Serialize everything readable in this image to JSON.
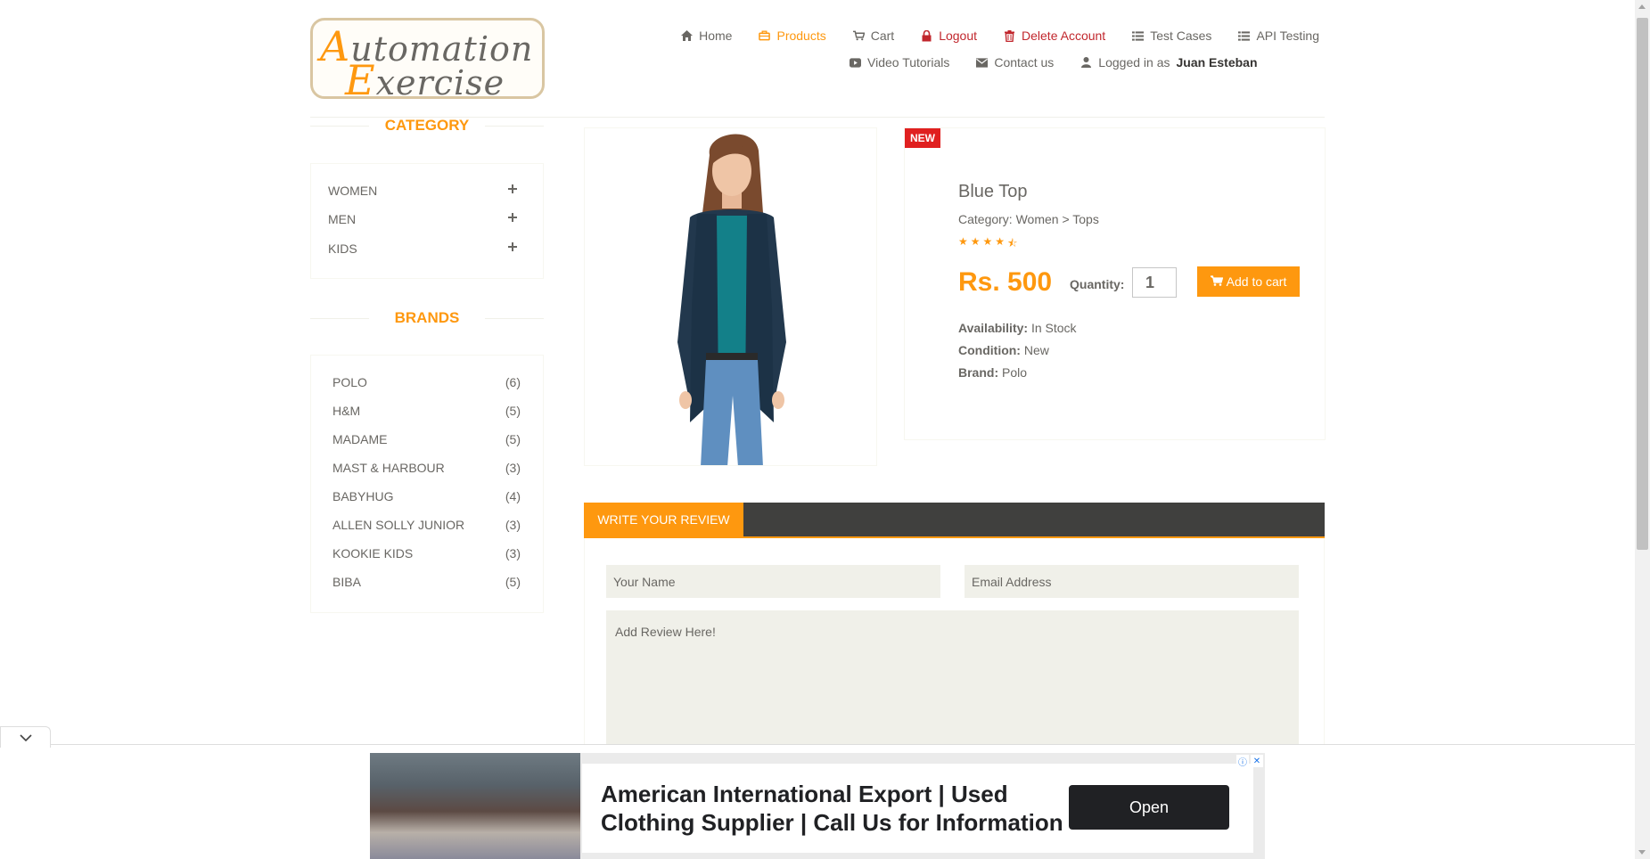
{
  "logo": {
    "line1_cap": "A",
    "line1_rest": "utomation",
    "line2_cap": "E",
    "line2_rest": "xercise"
  },
  "nav": {
    "home": "Home",
    "products": "Products",
    "cart": "Cart",
    "logout": "Logout",
    "delete_account": "Delete Account",
    "test_cases": "Test Cases",
    "api_testing": "API Testing",
    "video_tutorials": "Video Tutorials",
    "contact_us": "Contact us",
    "logged_in_prefix": "Logged in as",
    "logged_in_user": "Juan Esteban"
  },
  "sidebar": {
    "category_title": "CATEGORY",
    "categories": [
      {
        "label": "WOMEN"
      },
      {
        "label": "MEN"
      },
      {
        "label": "KIDS"
      }
    ],
    "brands_title": "BRANDS",
    "brands": [
      {
        "label": "POLO",
        "count": "(6)"
      },
      {
        "label": "H&M",
        "count": "(5)"
      },
      {
        "label": "MADAME",
        "count": "(5)"
      },
      {
        "label": "MAST & HARBOUR",
        "count": "(3)"
      },
      {
        "label": "BABYHUG",
        "count": "(4)"
      },
      {
        "label": "ALLEN SOLLY JUNIOR",
        "count": "(3)"
      },
      {
        "label": "KOOKIE KIDS",
        "count": "(3)"
      },
      {
        "label": "BIBA",
        "count": "(5)"
      }
    ]
  },
  "product": {
    "badge": "NEW",
    "name": "Blue Top",
    "category": "Category: Women > Tops",
    "rating": 4.5,
    "price": "Rs. 500",
    "quantity_label": "Quantity:",
    "quantity_value": "1",
    "add_to_cart": "Add to cart",
    "availability_label": "Availability:",
    "availability_value": "In Stock",
    "condition_label": "Condition:",
    "condition_value": "New",
    "brand_label": "Brand:",
    "brand_value": "Polo"
  },
  "review": {
    "tab": "WRITE YOUR REVIEW",
    "name_placeholder": "Your Name",
    "email_placeholder": "Email Address",
    "review_placeholder": "Add Review Here!"
  },
  "ad": {
    "line1": "American International Export | Used",
    "line2": "Clothing Supplier | Call Us for Information",
    "cta": "Open"
  },
  "colors": {
    "accent": "#fe980f",
    "danger": "#c1272d",
    "dark_bar": "#40403e"
  }
}
